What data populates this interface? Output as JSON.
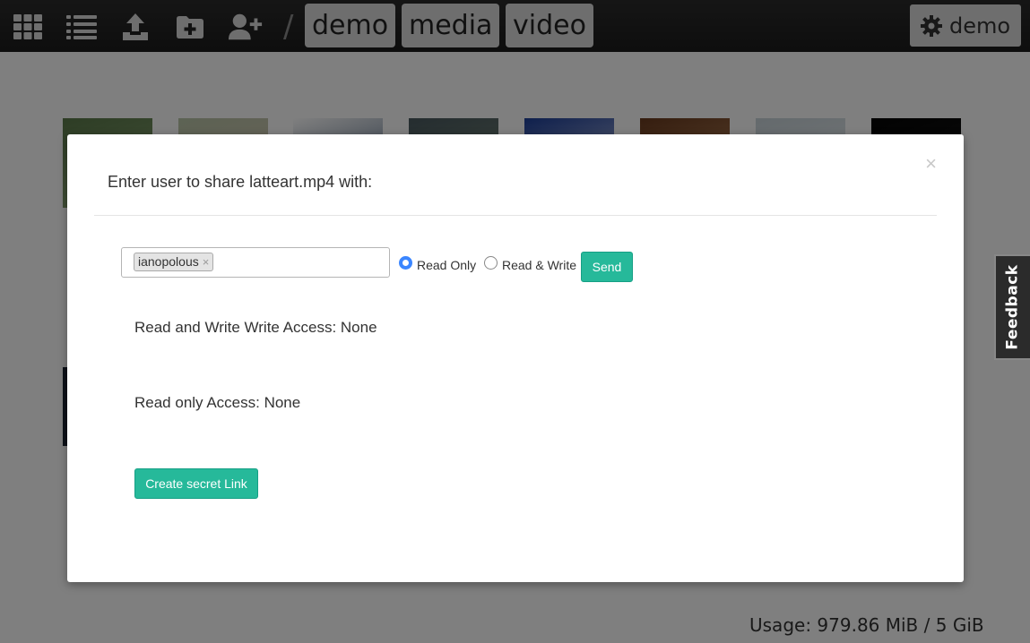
{
  "topbar": {
    "icons": [
      "apps-grid-icon",
      "list-view-icon",
      "upload-icon",
      "new-folder-icon",
      "add-user-icon"
    ],
    "breadcrumb": [
      "demo",
      "media",
      "video"
    ],
    "separator": "/",
    "user_label": "demo",
    "user_icon": "gear-icon"
  },
  "gallery": {
    "thumbnails": [
      {
        "name": "thumb-forest",
        "colors": [
          "#5b7a4a",
          "#8ea878"
        ]
      },
      {
        "name": "thumb-meadow",
        "colors": [
          "#b9c6a8",
          "#d8c0b0"
        ]
      },
      {
        "name": "thumb-document",
        "colors": [
          "#ffffff",
          "#2f4b6e"
        ]
      },
      {
        "name": "thumb-trees",
        "colors": [
          "#4a5a60",
          "#7d8f7a"
        ]
      },
      {
        "name": "thumb-screen",
        "colors": [
          "#1d3f9a",
          "#e8e8f0"
        ]
      },
      {
        "name": "thumb-coffee",
        "colors": [
          "#6a3a1e",
          "#c89a6c"
        ]
      },
      {
        "name": "thumb-sky",
        "colors": [
          "#c9d4da",
          "#eef2f4"
        ]
      },
      {
        "name": "thumb-dark",
        "colors": [
          "#050505",
          "#1a1a1a"
        ]
      }
    ]
  },
  "modal": {
    "title": "Enter user to share latteart.mp4 with:",
    "close_symbol": "×",
    "tag_value": "ianopolous",
    "tag_remove": "×",
    "radio_read_only": "Read Only",
    "radio_read_write": "Read & Write",
    "selected_permission": "Read Only",
    "send_label": "Send",
    "rw_access": "Read and Write Write Access: None",
    "ro_access": "Read only Access: None",
    "secret_link_label": "Create secret Link"
  },
  "usage": "Usage: 979.86 MiB / 5 GiB",
  "feedback": "Feedback",
  "colors": {
    "accent": "#26b99a",
    "radio_selected": "#3b86ff",
    "topbar": "#222222",
    "overlay": "rgba(0,0,0,0.5)"
  }
}
